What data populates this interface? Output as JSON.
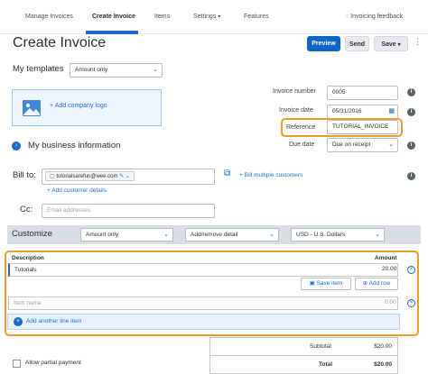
{
  "nav": {
    "tabs": [
      "Manage Invoices",
      "Create Invoice",
      "Items",
      "Settings",
      "Features"
    ],
    "active_tab": "Create Invoice",
    "feedback": "Invoicing feedback"
  },
  "page_title": "Create Invoice",
  "actions": {
    "preview": "Preview",
    "send": "Send",
    "save": "Save",
    "more": "⋮"
  },
  "templates": {
    "label": "My templates",
    "selected": "Amount only"
  },
  "logo": {
    "add_label": "+ Add company logo"
  },
  "invoice": {
    "number_label": "Invoice number",
    "number_value": "0005",
    "date_label": "Invoice date",
    "date_value": "05/31/2016",
    "reference_label": "Reference",
    "reference_value": "TUTORIAL_INVOICE",
    "due_label": "Due date",
    "due_value": "Due on receipt"
  },
  "business": {
    "label": "My business information"
  },
  "bill_to": {
    "label": "Bill to:",
    "email_chip": "tutorialsarefun@wee.com",
    "add_customer": "+ Add customer details",
    "multiple": "+ Bill multiple customers"
  },
  "cc": {
    "label": "Cc:",
    "placeholder": "Email addresses"
  },
  "customize": {
    "label": "Customize",
    "amount_select": "Amount only",
    "detail_select": "Add/remove detail",
    "currency_select": "USD - U.S. Dollars"
  },
  "items": {
    "col_description": "Description",
    "col_amount": "Amount",
    "row1": {
      "description": "Tutorials",
      "amount": "20.00"
    },
    "save_item": "Save item",
    "add_row": "Add row",
    "row2": {
      "placeholder": "Item name",
      "amount": "0.00"
    },
    "add_line": "Add another line item"
  },
  "totals": {
    "subtotal_label": "Subtotal",
    "subtotal_value": "$20.00",
    "total_label": "Total",
    "total_value": "$20.00"
  },
  "partial_payment": "Allow partial payment",
  "colors": {
    "accent": "#0e66c7",
    "highlight": "#f29b25"
  }
}
